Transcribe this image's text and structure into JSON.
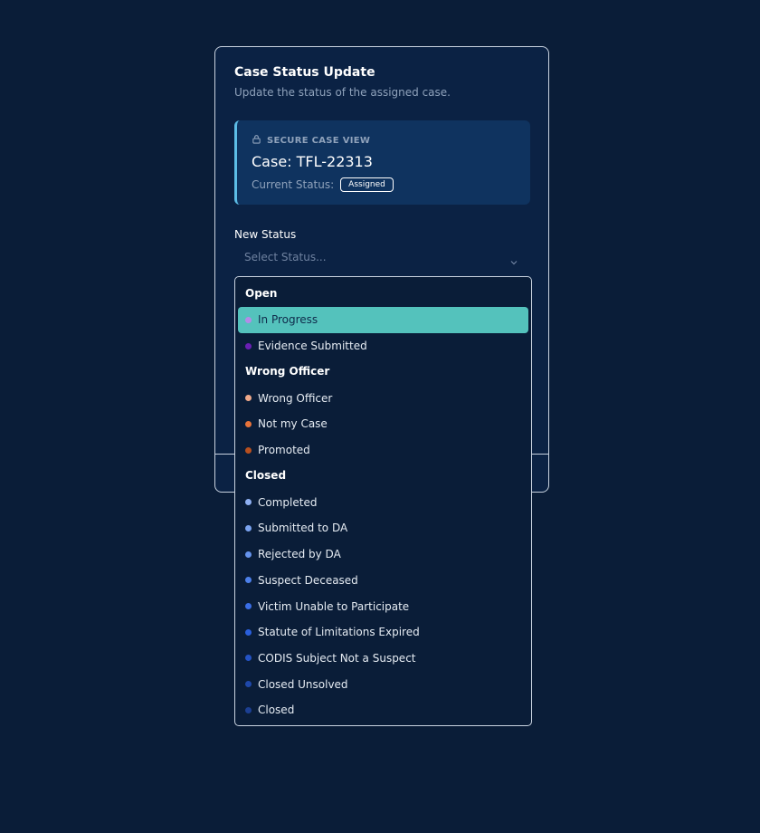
{
  "card": {
    "title": "Case Status Update",
    "subtitle": "Update the status of the assigned case."
  },
  "secure_view": {
    "label": "SECURE CASE VIEW",
    "icon": "lock-icon",
    "case_title": "Case: TFL-22313",
    "current_status_label": "Current Status:",
    "current_status_value": "Assigned"
  },
  "new_status": {
    "label": "New Status",
    "placeholder": "Select Status..."
  },
  "dropdown": {
    "groups": [
      {
        "header": "Open",
        "options": [
          {
            "label": "In Progress",
            "color": "#b48be8",
            "selected": true
          },
          {
            "label": "Evidence Submitted",
            "color": "#6a1fb3"
          }
        ]
      },
      {
        "header": "Wrong Officer",
        "options": [
          {
            "label": "Wrong Officer",
            "color": "#f0a98a"
          },
          {
            "label": "Not my Case",
            "color": "#e8733a"
          },
          {
            "label": "Promoted",
            "color": "#b8501f"
          }
        ]
      },
      {
        "header": "Closed",
        "options": [
          {
            "label": "Completed",
            "color": "#8fb0f2"
          },
          {
            "label": "Submitted to DA",
            "color": "#7aa3f0"
          },
          {
            "label": "Rejected by DA",
            "color": "#6693ec"
          },
          {
            "label": "Suspect Deceased",
            "color": "#4d80ea"
          },
          {
            "label": "Victim Unable to Participate",
            "color": "#3a6ee6"
          },
          {
            "label": "Statute of Limitations Expired",
            "color": "#2a5fdc"
          },
          {
            "label": "CODIS Subject Not a Suspect",
            "color": "#2453c4"
          },
          {
            "label": "Closed Unsolved",
            "color": "#1f48aa"
          },
          {
            "label": "Closed",
            "color": "#1c3f92"
          }
        ]
      }
    ]
  }
}
